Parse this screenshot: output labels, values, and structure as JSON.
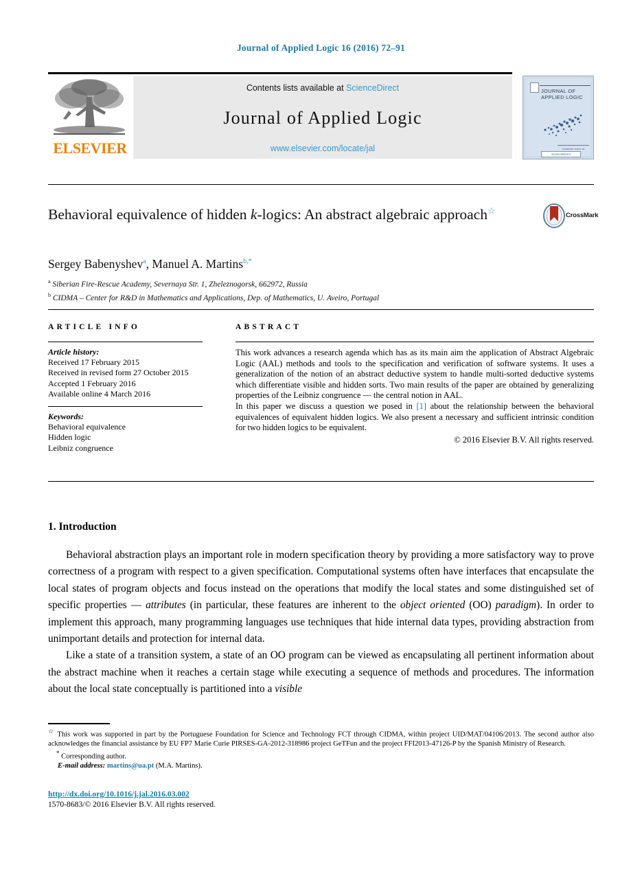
{
  "running_head": "Journal of Applied Logic 16 (2016) 72–91",
  "masthead": {
    "publisher_wordmark": "ELSEVIER",
    "contents_prefix": "Contents lists available at ",
    "contents_link": "ScienceDirect",
    "journal_title": "Journal of Applied Logic",
    "journal_url": "www.elsevier.com/locate/jal",
    "cover": {
      "title_line1": "JOURNAL OF",
      "title_line2": "APPLIED LOGIC",
      "foot_caption": "Available online at",
      "badge_text": "ScienceDirect"
    }
  },
  "article": {
    "title_main": "Behavioral equivalence of hidden k-logics: An abstract algebraic approach",
    "title_line1_pre": "Behavioral equivalence of hidden ",
    "title_k": "k",
    "title_line1_post": "-logics: An abstract algebraic",
    "title_line2": "approach",
    "title_footnote_mark": "☆",
    "crossmark_label": "CrossMark",
    "authors_plain": "Sergey Babenyshev a, Manuel A. Martins b,*",
    "author1": "Sergey Babenyshev",
    "author1_sup": "a",
    "author2": "Manuel A. Martins",
    "author2_sup": "b,*",
    "affiliation_a_mark": "a",
    "affiliation_a": "Siberian Fire-Rescue Academy, Severnaya Str. 1, Zheleznogorsk, 662972, Russia",
    "affiliation_b_mark": "b",
    "affiliation_b": "CIDMA – Center for R&D in Mathematics and Applications, Dep. of Mathematics, U. Aveiro, Portugal"
  },
  "article_info": {
    "heading": "ARTICLE INFO",
    "history_label": "Article history:",
    "history": [
      "Received 17 February 2015",
      "Received in revised form 27 October 2015",
      "Accepted 1 February 2016",
      "Available online 4 March 2016"
    ],
    "keywords_label": "Keywords:",
    "keywords": [
      "Behavioral equivalence",
      "Hidden logic",
      "Leibniz congruence"
    ]
  },
  "abstract": {
    "heading": "ABSTRACT",
    "paragraph1": "This work advances a research agenda which has as its main aim the application of Abstract Algebraic Logic (AAL) methods and tools to the specification and verification of software systems. It uses a generalization of the notion of an abstract deductive system to handle multi-sorted deductive systems which differentiate visible and hidden sorts. Two main results of the paper are obtained by generalizing properties of the Leibniz congruence — the central notion in AAL.",
    "paragraph2_pre": "In this paper we discuss a question we posed in ",
    "paragraph2_cite": "[1]",
    "paragraph2_post": " about the relationship between the behavioral equivalences of equivalent hidden logics. We also present a necessary and sufficient intrinsic condition for two hidden logics to be equivalent.",
    "copyright": "© 2016 Elsevier B.V. All rights reserved."
  },
  "body": {
    "section_number_title": "1. Introduction",
    "paragraph1_part1": "Behavioral abstraction plays an important role in modern specification theory by providing a more satisfactory way to prove correctness of a program with respect to a given specification. Computational systems often have interfaces that encapsulate the local states of program objects and focus instead on the operations that modify the local states and some distinguished set of specific properties — ",
    "paragraph1_em1": "attributes",
    "paragraph1_part2": " (in particular, these features are inherent to the ",
    "paragraph1_em2": "object oriented",
    "paragraph1_part3": " (OO) ",
    "paragraph1_em3": "paradigm",
    "paragraph1_part4": "). In order to implement this approach, many programming languages use techniques that hide internal data types, providing abstraction from unimportant details and protection for internal data.",
    "paragraph2_part1": "Like a state of a transition system, a state of an OO program can be viewed as encapsulating all pertinent information about the abstract machine when it reaches a certain stage while executing a sequence of methods and procedures. The information about the local state conceptually is partitioned into a ",
    "paragraph2_em1": "visible"
  },
  "footnotes": {
    "funding_mark": "☆",
    "funding": "This work was supported in part by the Portuguese Foundation for Science and Technology FCT through CIDMA, within project UID/MAT/04106/2013. The second author also acknowledges the financial assistance by EU FP7 Marie Curie PIRSES-GA-2012-318986 project GeTFun and the project FFI2013-47126-P by the Spanish Ministry of Research.",
    "corresponding_mark": "*",
    "corresponding": "Corresponding author.",
    "email_label": "E-mail address:",
    "email": "martins@ua.pt",
    "email_suffix": "(M.A. Martins).",
    "doi": "http://dx.doi.org/10.1016/j.jal.2016.03.002",
    "issn_line": "1570-8683/© 2016 Elsevier B.V. All rights reserved."
  }
}
